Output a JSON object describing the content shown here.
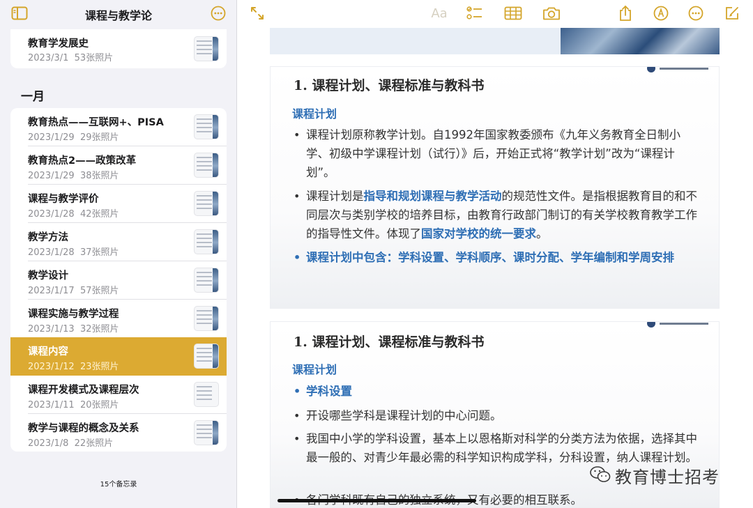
{
  "sidebar": {
    "title": "课程与教学论",
    "pinned_note": {
      "title": "教育学发展史",
      "date": "2023/3/1",
      "count": "53张照片"
    },
    "section_label": "一月",
    "notes": [
      {
        "title": "教育热点——互联网+、PISA",
        "date": "2023/1/29",
        "count": "29张照片"
      },
      {
        "title": "教育热点2——政策改革",
        "date": "2023/1/29",
        "count": "38张照片"
      },
      {
        "title": "课程与教学评价",
        "date": "2023/1/28",
        "count": "42张照片"
      },
      {
        "title": "教学方法",
        "date": "2023/1/28",
        "count": "37张照片"
      },
      {
        "title": "教学设计",
        "date": "2023/1/17",
        "count": "57张照片"
      },
      {
        "title": "课程实施与教学过程",
        "date": "2023/1/13",
        "count": "32张照片"
      },
      {
        "title": "课程内容",
        "date": "2023/1/12",
        "count": "23张照片",
        "selected": true
      },
      {
        "title": "课程开发模式及课程层次",
        "date": "2023/1/11",
        "count": "20张照片"
      },
      {
        "title": "教学与课程的概念及关系",
        "date": "2023/1/8",
        "count": "22张照片"
      }
    ],
    "footer": "15个备忘录"
  },
  "toolbar": {
    "format_label": "Aa",
    "icons": [
      "expand-icon",
      "checklist-icon",
      "table-icon",
      "camera-icon",
      "share-icon",
      "markup-icon",
      "more-icon",
      "compose-icon"
    ]
  },
  "slide1": {
    "title": "1. 课程计划、课程标准与教科书",
    "subtitle": "课程计划",
    "b1": "课程计划原称教学计划。自1992年国家教委颁布《九年义务教育全日制小学、初级中学课程计划（试行）》后，开始正式将“教学计划”改为“课程计划”。",
    "b2_a": "课程计划是",
    "b2_hl1": "指导和规划课程与教学活动",
    "b2_b": "的规范性文件。是指根据教育目的和不同层次与类别学校的培养目标，由教育行政部门制订的有关学校教育教学工作的指导性文件。体现了",
    "b2_hl2": "国家对学校的统一要求",
    "b2_c": "。",
    "b3": "课程计划中包含：学科设置、学科顺序、课时分配、学年编制和学周安排"
  },
  "slide2": {
    "title": "1. 课程计划、课程标准与教科书",
    "subtitle": "课程计划",
    "b1": "学科设置",
    "b2": "开设哪些学科是课程计划的中心问题。",
    "b3": "我国中小学的学科设置，基本上以恩格斯对科学的分类方法为依据，选择其中最一般的、对青少年最必需的科学知识构成学科，分科设置，纳人课程计划。",
    "b4": "各门学科既有自己的独立系统，又有必要的相互联系。"
  },
  "watermark": {
    "text": "教育博士招考"
  },
  "colors": {
    "selected": "#dcaa32",
    "accent_blue": "#2f6fb5",
    "toolbar_icon": "#d4a52a"
  }
}
